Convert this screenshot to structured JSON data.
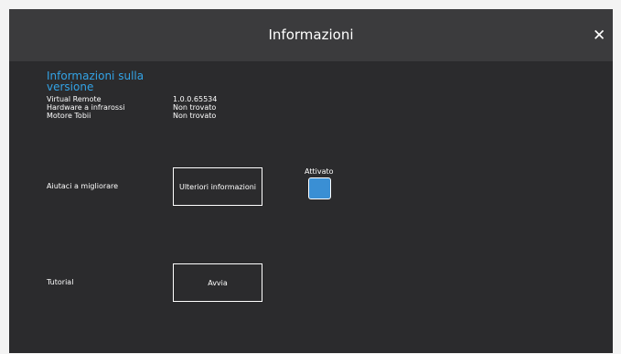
{
  "dialog": {
    "title": "Informazioni",
    "close_glyph": "✕"
  },
  "version_info": {
    "heading": "Informazioni sulla versione",
    "rows": [
      {
        "label": "Virtual Remote",
        "value": "1.0.0.65534"
      },
      {
        "label": "Hardware a infrarossi",
        "value": "Non trovato"
      },
      {
        "label": "Motore Tobii",
        "value": "Non trovato"
      }
    ]
  },
  "improve": {
    "label": "Aiutaci a migliorare",
    "more_info_button": "Ulteriori informazioni",
    "toggle_label": "Attivato",
    "toggle_on": true
  },
  "tutorial": {
    "label": "Tutorial",
    "start_button": "Avvia"
  },
  "colors": {
    "background": "#2b2b2d",
    "titlebar": "#3b3b3d",
    "accent": "#33a3e6",
    "toggle_fill": "#3a8fd4"
  }
}
